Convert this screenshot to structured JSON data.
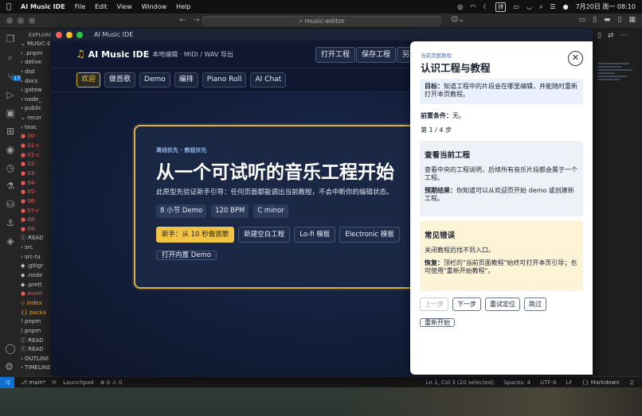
{
  "menubar": {
    "app_name": "AI Music IDE",
    "items": [
      "File",
      "Edit",
      "View",
      "Window",
      "Help"
    ],
    "kbd": "拼",
    "datetime": "7月20日 周一  08:10"
  },
  "vscode": {
    "search": "⌕ music-editor",
    "explorer_header": "EXPLORER",
    "sidebar_rows": [
      {
        "t": "⌄ MUSIC-E",
        "c": ""
      },
      {
        "t": "  › .pnpm",
        "c": ""
      },
      {
        "t": "  › delive",
        "c": ""
      },
      {
        "t": "  › dist",
        "c": ""
      },
      {
        "t": "  › docs",
        "c": ""
      },
      {
        "t": "  › gatew",
        "c": ""
      },
      {
        "t": "  › node_",
        "c": ""
      },
      {
        "t": "  › public",
        "c": ""
      },
      {
        "t": "  ⌄ recor",
        "c": ""
      },
      {
        "t": "    › teac",
        "c": ""
      },
      {
        "t": "    ● 00-",
        "c": "red"
      },
      {
        "t": "    ● 01-c",
        "c": "red"
      },
      {
        "t": "    ● 01-c",
        "c": "red"
      },
      {
        "t": "    ● 02-",
        "c": "red"
      },
      {
        "t": "    ● 03-",
        "c": "red"
      },
      {
        "t": "    ● 04-",
        "c": "red"
      },
      {
        "t": "    ● 05-",
        "c": "red"
      },
      {
        "t": "    ● 06-",
        "c": "red"
      },
      {
        "t": "    ● 07-r",
        "c": "red"
      },
      {
        "t": "    ● 08-",
        "c": "red"
      },
      {
        "t": "    ● 09-",
        "c": "red"
      },
      {
        "t": "    ⓘ READ",
        "c": ""
      },
      {
        "t": "  › src",
        "c": ""
      },
      {
        "t": "  › src-ta",
        "c": ""
      },
      {
        "t": "  ◆ .gitigr",
        "c": ""
      },
      {
        "t": "  ◆ .node",
        "c": ""
      },
      {
        "t": "  ◆ .prett",
        "c": ""
      },
      {
        "t": "  ● eslint",
        "c": "red"
      },
      {
        "t": "  ◇ index",
        "c": "orange"
      },
      {
        "t": "  {} packa",
        "c": "orange"
      },
      {
        "t": "  ! pnpm",
        "c": ""
      },
      {
        "t": "  ! pnpm",
        "c": ""
      },
      {
        "t": "  ⓘ READ",
        "c": ""
      },
      {
        "t": "  ⓘ READ",
        "c": ""
      },
      {
        "t": "› OUTLINE",
        "c": ""
      },
      {
        "t": "› TIMELINE",
        "c": ""
      }
    ],
    "scm_badge": "178",
    "status": {
      "branch": "⎇ main*",
      "launchpad": "Launchpad",
      "problems": "⊗ 0 ⚠ 0",
      "cursor": "Ln 1, Col 3 (20 selected)",
      "spaces": "Spaces: 4",
      "encoding": "UTF-8",
      "eol": "LF",
      "language": "{} Markdown"
    }
  },
  "app": {
    "window_title": "AI Music IDE",
    "brand": "AI Music IDE",
    "brand_sub": "本地编辑 · MIDI / WAV 导出",
    "header_buttons": [
      "打开工程",
      "保存工程",
      "另存"
    ],
    "tabs": [
      "欢迎",
      "做首歌",
      "Demo",
      "编排",
      "Piano Roll",
      "AI Chat"
    ],
    "hero": {
      "eyebrow": "离线优先 · 教程优先",
      "title": "从一个可试听的音乐工程开始",
      "desc": "此原型先验证新手引导：任何页面都能调出当前教程，不会中断你的编辑状态。",
      "chips": [
        "8 小节 Demo",
        "120 BPM",
        "C minor"
      ],
      "actions": [
        "新手：从 10 秒做首歌",
        "新建空白工程",
        "Lo-fi 模板",
        "Electronic 模板"
      ],
      "open_demo": "打开内置 Demo"
    }
  },
  "drawer": {
    "eyebrow": "当前页面教程",
    "title": "认识工程与教程",
    "goal_label": "目标：",
    "goal_text": "知道工程中的片段会在哪里编辑，并能随时重新打开本页教程。",
    "prereq_label": "前置条件：",
    "prereq_text": "无。",
    "step": "第 1 / 4 步",
    "card1": {
      "title": "查看当前工程",
      "text": "查看中央的工程说明，后续所有音乐片段都会属于一个工程。",
      "expect_label": "预期结果：",
      "expect_text": "你知道可以从欢迎页开始 demo 或创建新工程。"
    },
    "card2": {
      "title": "常见错误",
      "text": "关闭教程后找不到入口。",
      "fix_label": "恢复：",
      "fix_text": "顶栏的\"当前页面教程\"始终可打开本页引导；也可使用\"重新开始教程\"。"
    },
    "buttons": {
      "prev": "上一步",
      "next": "下一步",
      "relocate": "重试定位",
      "skip": "跳过",
      "restart": "重新开始"
    }
  },
  "colors": {
    "accent": "#f1c345",
    "vscode_blue": "#0e6fd1",
    "app_bg": "#0f1830"
  }
}
